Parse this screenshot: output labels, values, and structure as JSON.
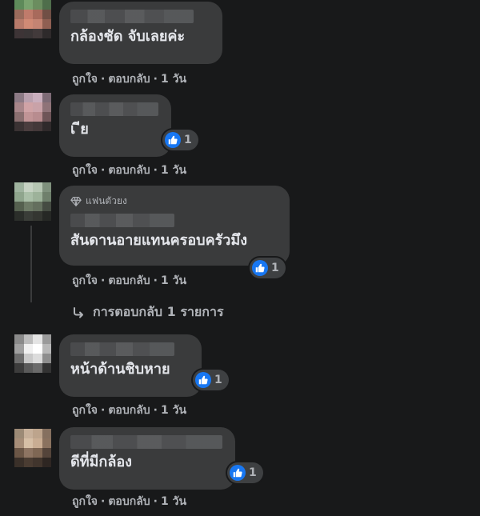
{
  "comments": [
    {
      "text": "กล้องชัด จับเลยค่ะ",
      "actions": {
        "like": "ถูกใจ",
        "reply": "ตอบกลับ",
        "time": "1 วัน"
      },
      "avatar_colors": [
        "#5e8a5a",
        "#7aa36f",
        "#6b8d5f",
        "#4f6e4b",
        "#9a6b5c",
        "#c07b6b",
        "#a86a5c",
        "#704f45",
        "#b77a6a",
        "#d08a75",
        "#c48473",
        "#8f5f52",
        "#3d3436",
        "#3a3536",
        "#423a3b",
        "#2e2a2b"
      ]
    },
    {
      "text": "เ  ีย",
      "reaction_count": "1",
      "actions": {
        "like": "ถูกใจ",
        "reply": "ตอบกลับ",
        "time": "1 วัน"
      },
      "avatar_colors": [
        "#8c7a85",
        "#b9a0ae",
        "#c9aebd",
        "#7e6b76",
        "#a8868a",
        "#d0a3a6",
        "#c9a2a8",
        "#8f7378",
        "#8a6f70",
        "#c19496",
        "#b88c8f",
        "#6f5558",
        "#3a3233",
        "#4a3d3e",
        "#433839",
        "#2f2a2b"
      ]
    },
    {
      "badge": "แฟนตัวยง",
      "text": "สันดานอายแทนครอบครัวมึง",
      "reaction_count": "1",
      "actions": {
        "like": "ถูกใจ",
        "reply": "ตอบกลับ",
        "time": "1 วัน"
      },
      "replies_label": "การตอบกลับ 1 รายการ",
      "avatar_colors": [
        "#9fb39f",
        "#c6d2c3",
        "#b6c6b3",
        "#7f917d",
        "#8fa58d",
        "#aabfa8",
        "#9db29a",
        "#6f806c",
        "#55604f",
        "#6d7a66",
        "#646f5e",
        "#454b42",
        "#2b2e2a",
        "#3a3d38",
        "#343631",
        "#262825"
      ]
    },
    {
      "text": "หน้าด้านชิบหาย",
      "reaction_count": "1",
      "actions": {
        "like": "ถูกใจ",
        "reply": "ตอบกลับ",
        "time": "1 วัน"
      },
      "avatar_colors": [
        "#8a8a8a",
        "#bdbdbd",
        "#e4e4e4",
        "#9a9a9a",
        "#a0a0a0",
        "#f0f0f0",
        "#ffffff",
        "#b8b8b8",
        "#6d6d6d",
        "#c9c9c9",
        "#dcdcdc",
        "#8e8e8e",
        "#3c3c3c",
        "#5a5a5a",
        "#6a6a6a",
        "#333333"
      ]
    },
    {
      "text": "ดีที่มีกล้อง",
      "reaction_count": "1",
      "actions": {
        "like": "ถูกใจ",
        "reply": "ตอบกลับ",
        "time": "1 วัน"
      },
      "avatar_colors": [
        "#9c8a76",
        "#c7b09a",
        "#bda48c",
        "#85705f",
        "#a68d78",
        "#d6bfa6",
        "#c9ad93",
        "#8a725f",
        "#6b5646",
        "#8d7462",
        "#7f6754",
        "#54443a",
        "#3a3029",
        "#4a3c32",
        "#41352d",
        "#2e2622"
      ]
    }
  ],
  "colors": {
    "background": "#18191a",
    "bubble": "#3a3b3c",
    "like_blue": "#1877f2",
    "text": "#e4e6eb",
    "secondary_text": "#b0b3b8"
  },
  "icons": {
    "like": "thumbs-up-icon",
    "badge": "diamond-icon",
    "reply": "reply-arrow-icon"
  }
}
